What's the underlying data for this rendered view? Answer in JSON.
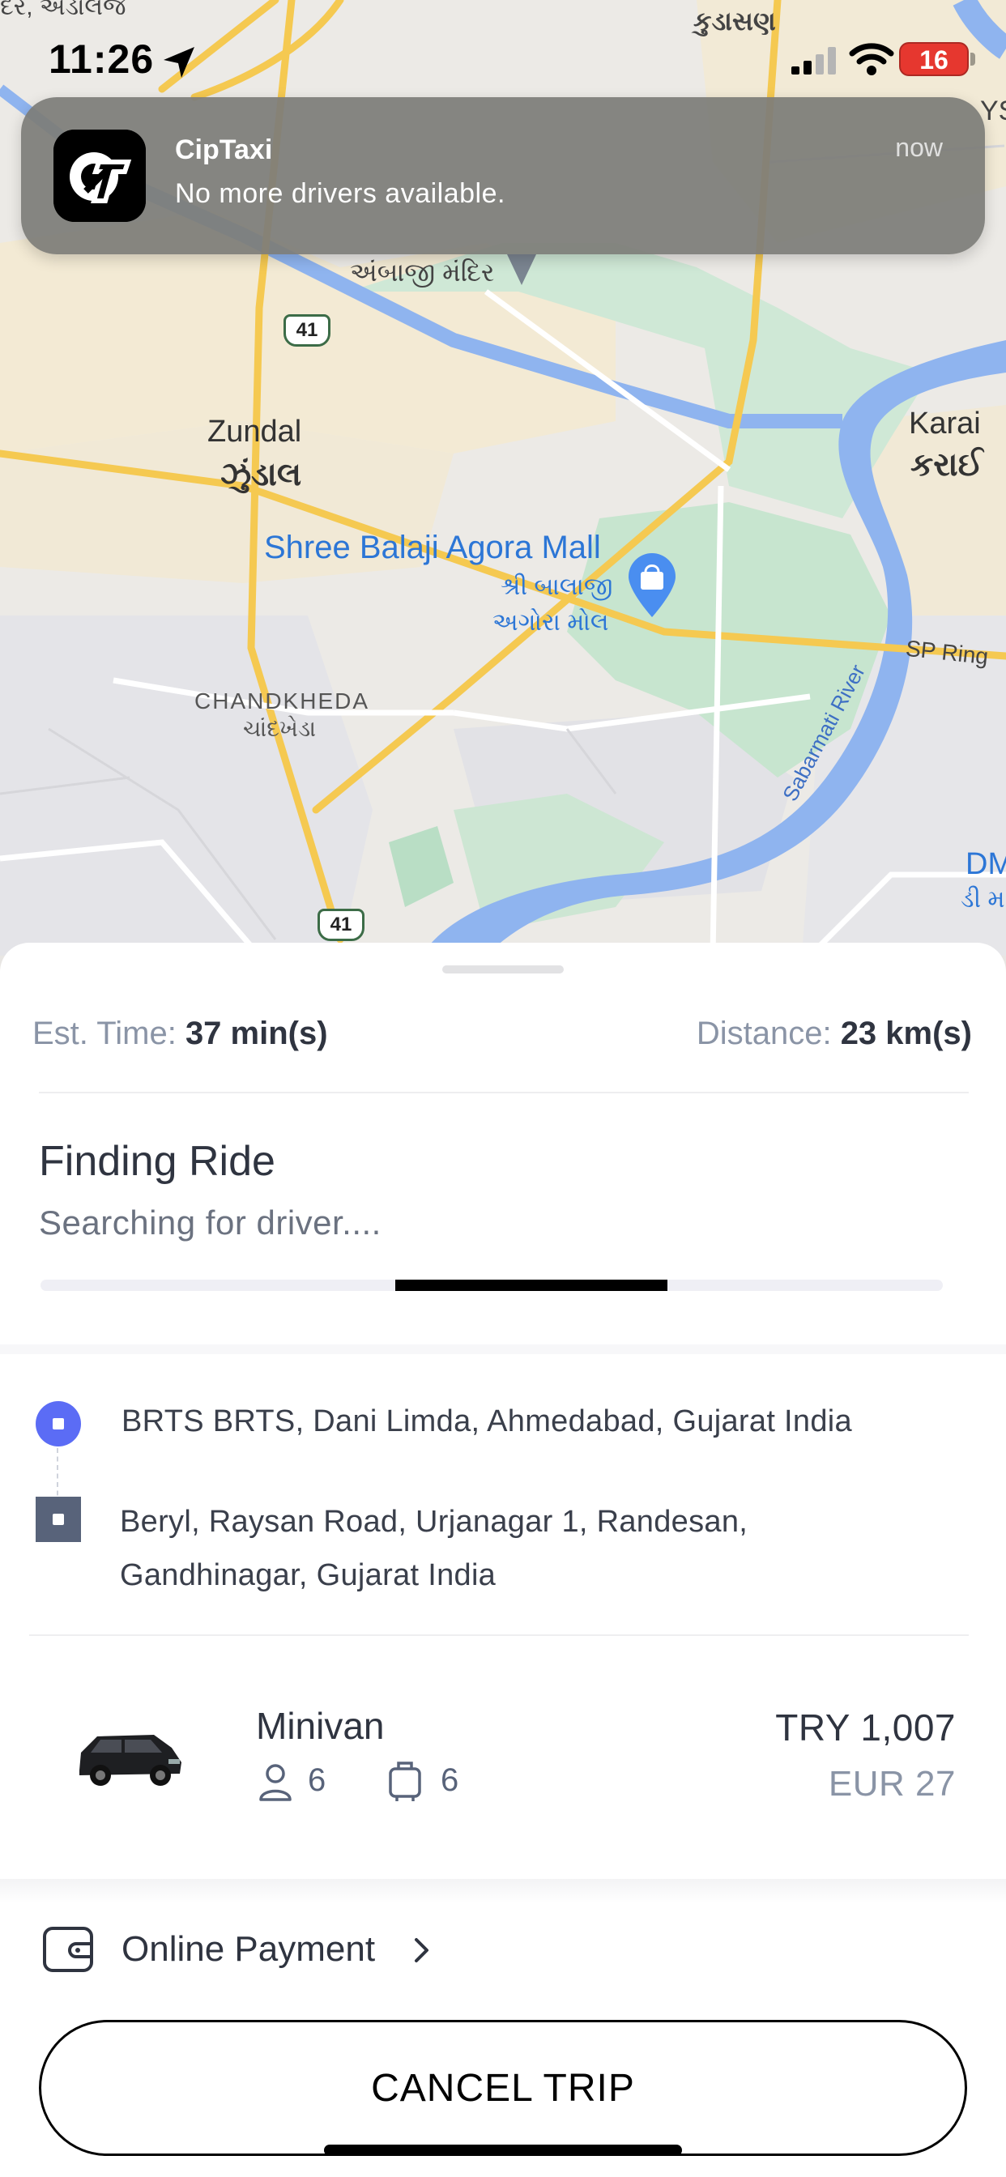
{
  "status_bar": {
    "time": "11:26",
    "battery": "16"
  },
  "notification": {
    "app": "CipTaxi",
    "message": "No more drivers available.",
    "time": "now"
  },
  "map": {
    "labels": {
      "top_left": "દર, અડાલજ",
      "top_center": "કુડાસણ",
      "top_right": "YS",
      "ambaji_mandir": "અંબાજી મંદિર",
      "highway_41_top": "41",
      "zundal_en": "Zundal",
      "zundal_gu": "ઝુંડાલ",
      "karai_en": "Karai",
      "karai_gu": "કરાઈ",
      "mall_en": "Shree Balaji Agora Mall",
      "mall_gu_1": "શ્રી બાલાજી",
      "mall_gu_2": "અગોરા મોલ",
      "sp_ring": "SP Ring",
      "chandkheda_en": "CHANDKHEDA",
      "chandkheda_gu": "ચાંદખેડા",
      "sabarmati": "Sabarmati River",
      "dm_en": "DM",
      "dm_gu": "ડી મ",
      "highway_41_bottom": "41"
    }
  },
  "trip": {
    "est_time_label": "Est. Time:",
    "est_time_value": "37 min(s)",
    "distance_label": "Distance:",
    "distance_value": "23 km(s)",
    "status_title": "Finding Ride",
    "status_subtitle": "Searching for driver....",
    "pickup": "BRTS BRTS, Dani Limda, Ahmedabad, Gujarat India",
    "dropoff": "Beryl, Raysan Road, Urjanagar 1, Randesan, Gandhinagar, Gujarat India"
  },
  "vehicle": {
    "name": "Minivan",
    "passengers": "6",
    "luggage": "6",
    "price_primary": "TRY 1,007",
    "price_secondary": "EUR 27"
  },
  "payment": {
    "label": "Online Payment"
  },
  "actions": {
    "cancel_label": "CANCEL TRIP"
  }
}
